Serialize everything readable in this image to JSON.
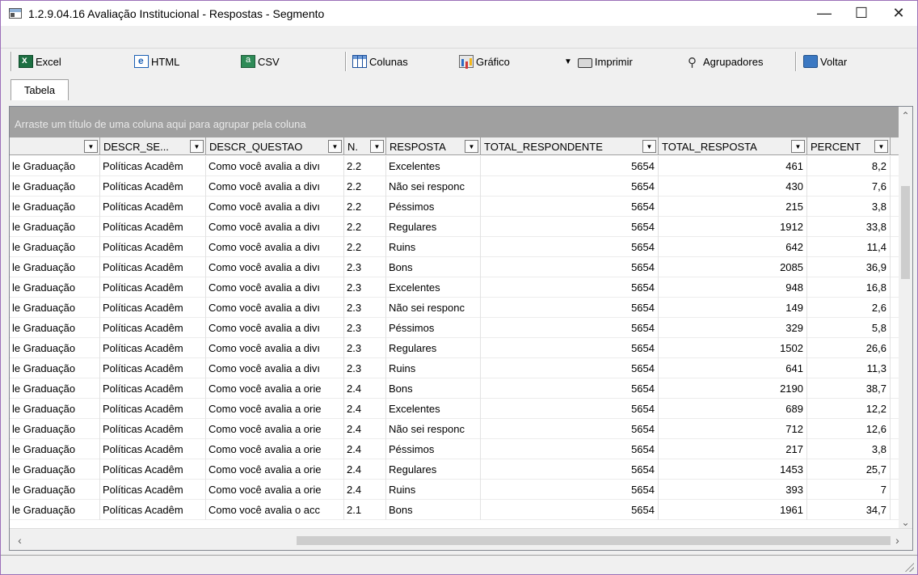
{
  "window": {
    "title": "1.2.9.04.16 Avaliação Institucional - Respostas - Segmento",
    "minimize": "—",
    "maximize": "☐",
    "close": "✕"
  },
  "toolbar": {
    "excel": "Excel",
    "html": "HTML",
    "csv": "CSV",
    "columns": "Colunas",
    "chart": "Gráfico",
    "print": "Imprimir",
    "groupers": "Agrupadores",
    "back": "Voltar"
  },
  "tabs": {
    "active": "Tabela"
  },
  "grid": {
    "group_hint": "Arraste um título de uma coluna aqui para agrupar pela coluna",
    "headers": [
      "",
      "DESCR_SE...",
      "DESCR_QUESTAO",
      "N.",
      "RESPOSTA",
      "TOTAL_RESPONDENTE",
      "TOTAL_RESPOSTA",
      "PERCENT"
    ],
    "rows": [
      [
        "le Graduação",
        "Políticas Acadêm",
        "Como você avalia a divı",
        "2.2",
        "Excelentes",
        "5654",
        "461",
        "8,2"
      ],
      [
        "le Graduação",
        "Políticas Acadêm",
        "Como você avalia a divı",
        "2.2",
        "Não sei responc",
        "5654",
        "430",
        "7,6"
      ],
      [
        "le Graduação",
        "Políticas Acadêm",
        "Como você avalia a divı",
        "2.2",
        "Péssimos",
        "5654",
        "215",
        "3,8"
      ],
      [
        "le Graduação",
        "Políticas Acadêm",
        "Como você avalia a divı",
        "2.2",
        "Regulares",
        "5654",
        "1912",
        "33,8"
      ],
      [
        "le Graduação",
        "Políticas Acadêm",
        "Como você avalia a divı",
        "2.2",
        "Ruins",
        "5654",
        "642",
        "11,4"
      ],
      [
        "le Graduação",
        "Políticas Acadêm",
        "Como você avalia a divı",
        "2.3",
        "Bons",
        "5654",
        "2085",
        "36,9"
      ],
      [
        "le Graduação",
        "Políticas Acadêm",
        "Como você avalia a divı",
        "2.3",
        "Excelentes",
        "5654",
        "948",
        "16,8"
      ],
      [
        "le Graduação",
        "Políticas Acadêm",
        "Como você avalia a divı",
        "2.3",
        "Não sei responc",
        "5654",
        "149",
        "2,6"
      ],
      [
        "le Graduação",
        "Políticas Acadêm",
        "Como você avalia a divı",
        "2.3",
        "Péssimos",
        "5654",
        "329",
        "5,8"
      ],
      [
        "le Graduação",
        "Políticas Acadêm",
        "Como você avalia a divı",
        "2.3",
        "Regulares",
        "5654",
        "1502",
        "26,6"
      ],
      [
        "le Graduação",
        "Políticas Acadêm",
        "Como você avalia a divı",
        "2.3",
        "Ruins",
        "5654",
        "641",
        "11,3"
      ],
      [
        "le Graduação",
        "Políticas Acadêm",
        "Como você avalia a orie",
        "2.4",
        "Bons",
        "5654",
        "2190",
        "38,7"
      ],
      [
        "le Graduação",
        "Políticas Acadêm",
        "Como você avalia a orie",
        "2.4",
        "Excelentes",
        "5654",
        "689",
        "12,2"
      ],
      [
        "le Graduação",
        "Políticas Acadêm",
        "Como você avalia a orie",
        "2.4",
        "Não sei responc",
        "5654",
        "712",
        "12,6"
      ],
      [
        "le Graduação",
        "Políticas Acadêm",
        "Como você avalia a orie",
        "2.4",
        "Péssimos",
        "5654",
        "217",
        "3,8"
      ],
      [
        "le Graduação",
        "Políticas Acadêm",
        "Como você avalia a orie",
        "2.4",
        "Regulares",
        "5654",
        "1453",
        "25,7"
      ],
      [
        "le Graduação",
        "Políticas Acadêm",
        "Como você avalia a orie",
        "2.4",
        "Ruins",
        "5654",
        "393",
        "7"
      ],
      [
        "le Graduação",
        "Políticas Acadêm",
        "Como você avalia o acc",
        "2.1",
        "Bons",
        "5654",
        "1961",
        "34,7"
      ]
    ]
  }
}
